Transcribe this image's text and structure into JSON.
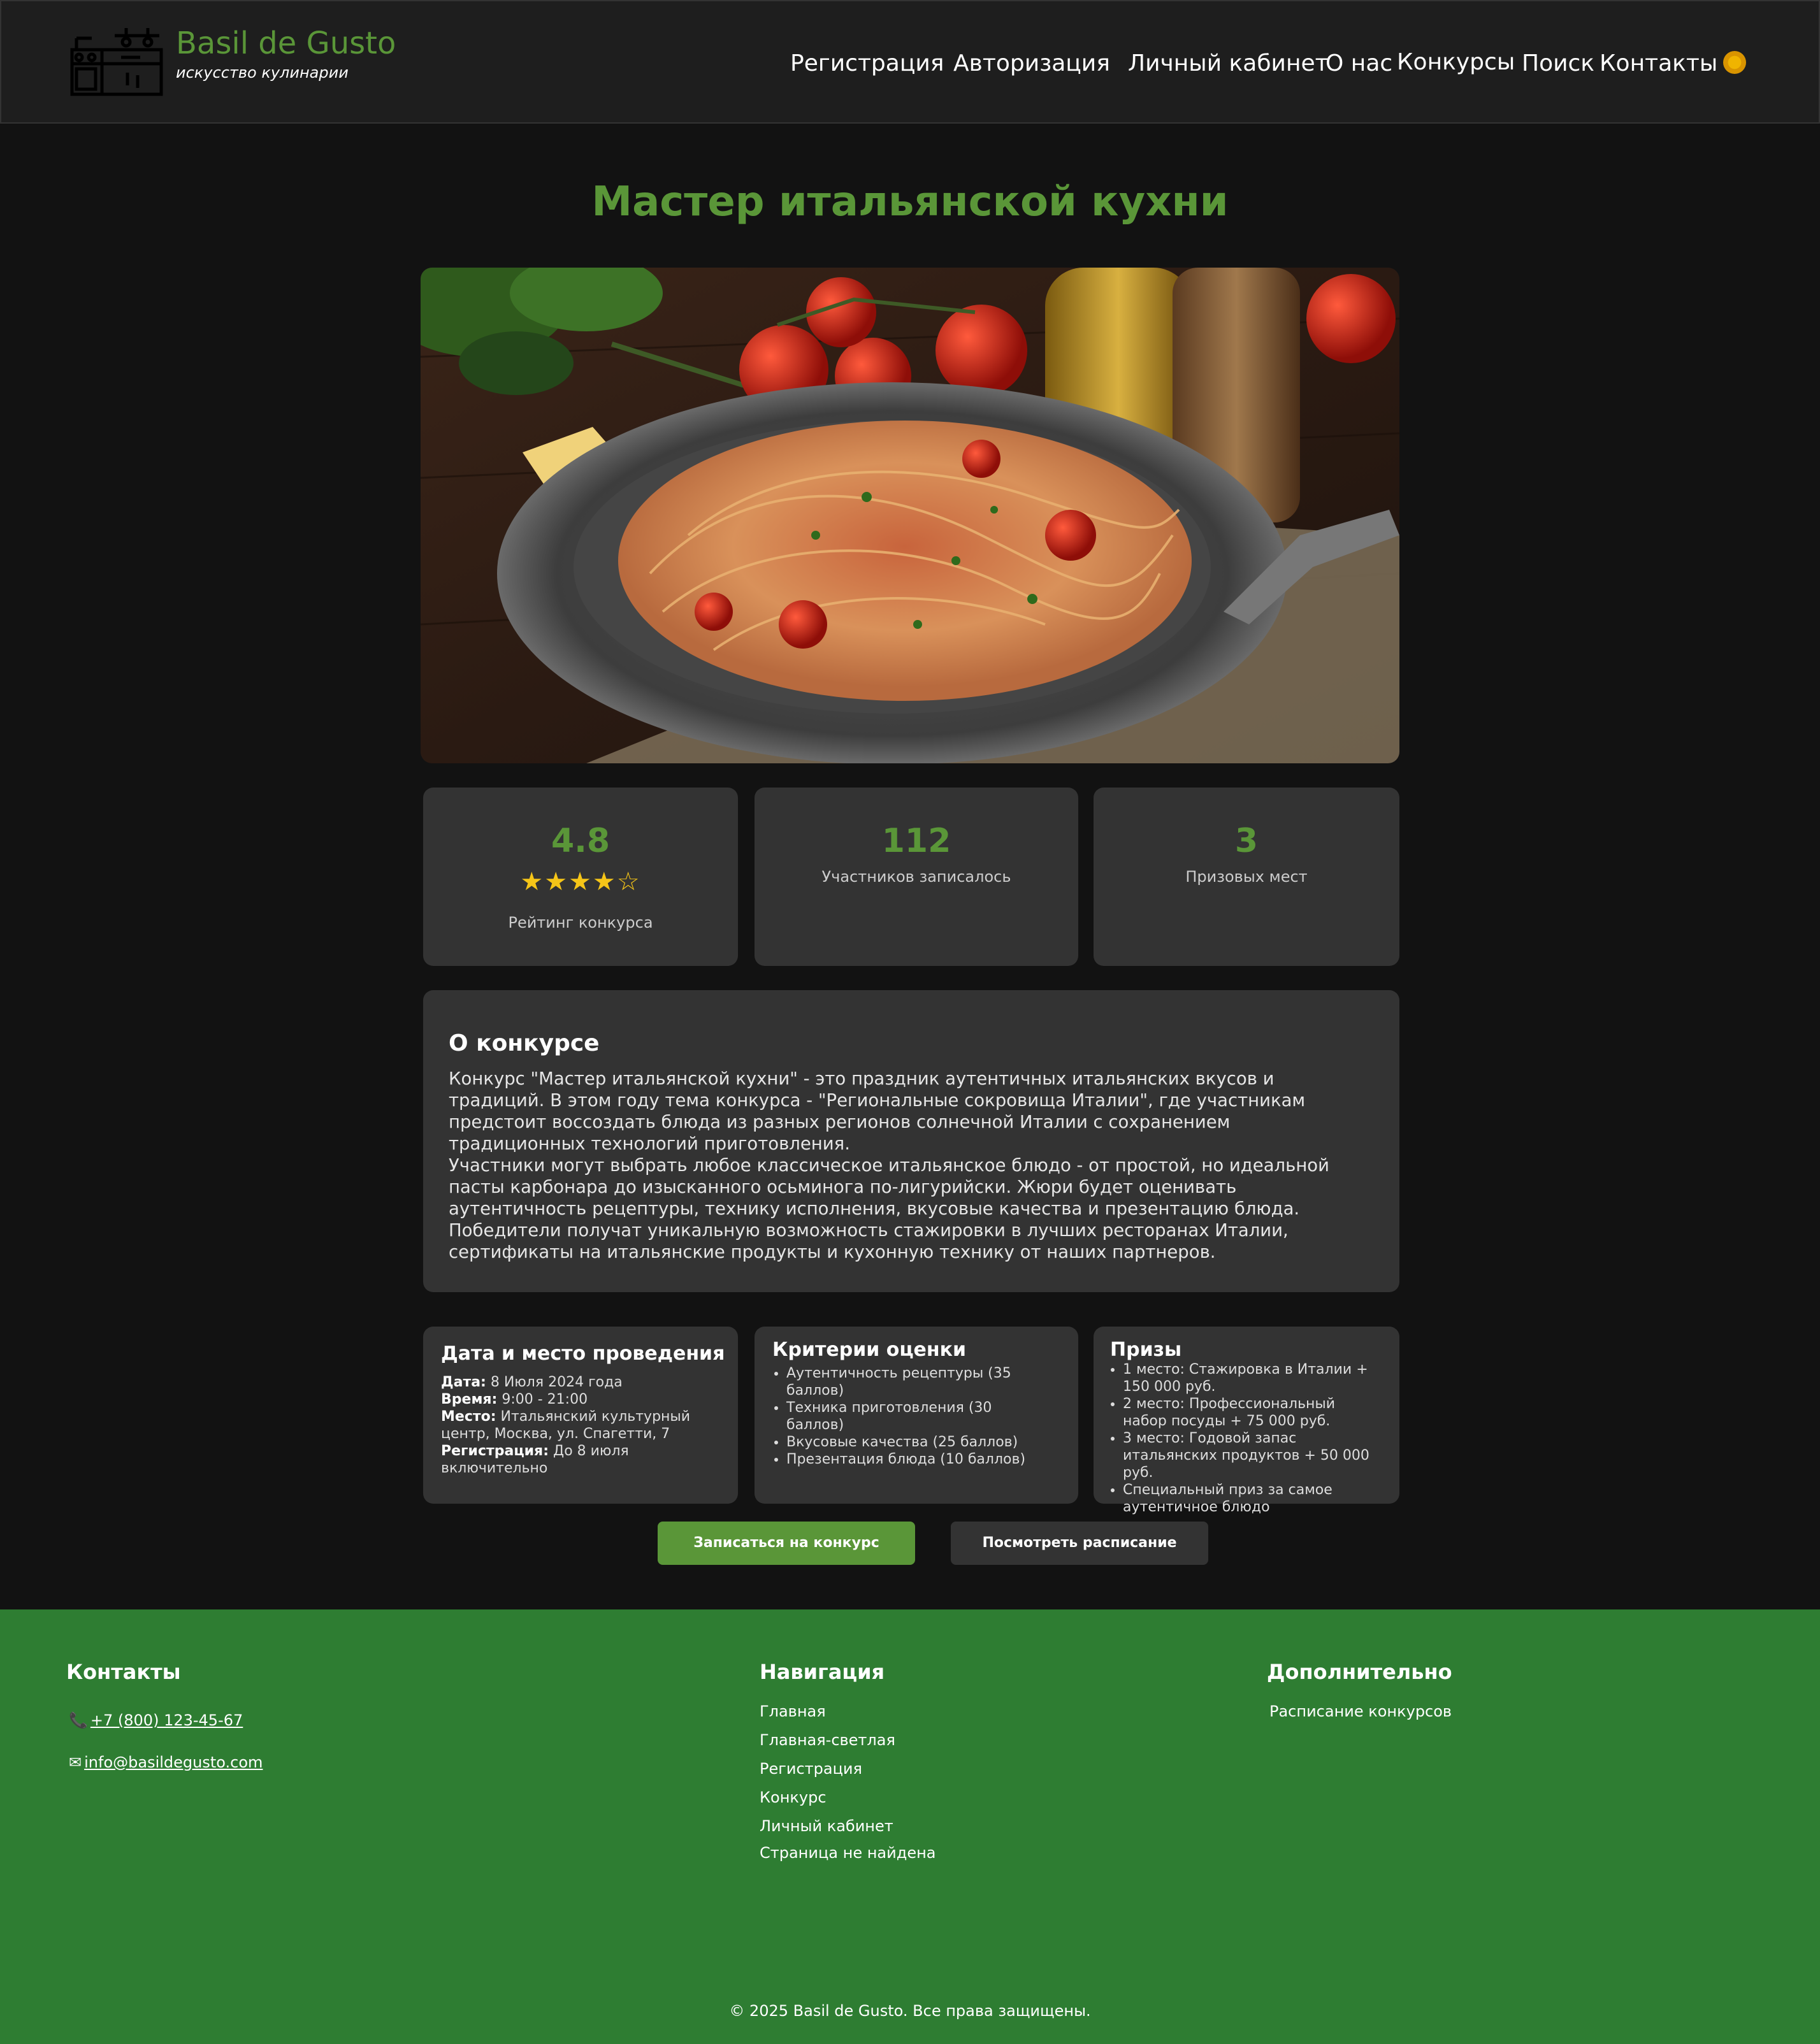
{
  "header": {
    "brand_name": "Basil de Gusto",
    "brand_tagline": "искусство кулинарии",
    "nav": [
      "Регистрация",
      "Авторизация",
      "Личный кабинет",
      "О нас",
      "Конкурсы",
      "Поиск",
      "Контакты"
    ],
    "theme_icon": "sun-icon"
  },
  "main": {
    "title": "Мастер итальянской кухни",
    "hero_icon": "spaghetti-photo",
    "stats": [
      {
        "value": "4.8",
        "stars": "★★★★☆",
        "rating": 4.8,
        "label": "Рейтинг конкурса"
      },
      {
        "value": "112",
        "label": "Участников записалось"
      },
      {
        "value": "3",
        "label": "Призовых мест"
      }
    ],
    "about": {
      "title": "О конкурсе",
      "paragraphs": [
        "Конкурс \"Мастер итальянской кухни\" - это праздник аутентичных итальянских вкусов и традиций. В этом году тема конкурса - \"Региональные сокровища Италии\", где участникам предстоит воссоздать блюда из разных регионов солнечной Италии с сохранением традиционных технологий приготовления.",
        "Участники могут выбрать любое классическое итальянское блюдо - от простой, но идеальной пасты карбонара до изысканного осьминога по-лигурийски. Жюри будет оценивать аутентичность рецептуры, технику исполнения, вкусовые качества и презентацию блюда.",
        "Победители получат уникальную возможность стажировки в лучших ресторанах Италии, сертификаты на итальянские продукты и кухонную технику от наших партнеров."
      ]
    },
    "date_place": {
      "title": "Дата и место проведения",
      "date_label": "Дата:",
      "date_value": "8 Июля 2024 года",
      "time_label": "Время:",
      "time_value": "9:00 - 21:00",
      "place_label": "Место:",
      "place_value": "Итальянский культурный центр, Москва, ул. Спагетти, 7",
      "reg_label": "Регистрация:",
      "reg_value": "До 8 июля включительно"
    },
    "criteria": {
      "title": "Критерии оценки",
      "items": [
        "Аутентичность рецептуры (35 баллов)",
        "Техника приготовления (30 баллов)",
        "Вкусовые качества (25 баллов)",
        "Презентация блюда (10 баллов)"
      ]
    },
    "prizes": {
      "title": "Призы",
      "items": [
        "1 место: Стажировка в Италии + 150 000 руб.",
        "2 место: Профессиональный набор посуды + 75 000 руб.",
        "3 место: Годовой запас итальянских продуктов + 50 000 руб.",
        "Специальный приз за самое аутентичное блюдо"
      ]
    },
    "buttons": {
      "register": "Записаться на конкурс",
      "schedule": "Посмотреть расписание"
    }
  },
  "footer": {
    "contacts_title": "Контакты",
    "phone": "+7 (800) 123-45-67",
    "phone_icon": "phone-icon",
    "email": "info@basildegusto.com",
    "email_icon": "envelope-icon",
    "nav_title": "Навигация",
    "nav_links": [
      "Главная",
      "Главная-светлая",
      "Регистрация",
      "Конкурс",
      "Личный кабинет",
      "Страница не найдена"
    ],
    "extra_title": "Дополнительно",
    "extra_links": [
      "Расписание конкурсов"
    ],
    "copyright": "© 2025 Basil de Gusto. Все права защищены."
  },
  "colors": {
    "accent": "#5a9638",
    "footer_bg": "#2e7d32",
    "card_bg": "#333333",
    "page_bg": "#121212",
    "star": "#f5c518"
  }
}
